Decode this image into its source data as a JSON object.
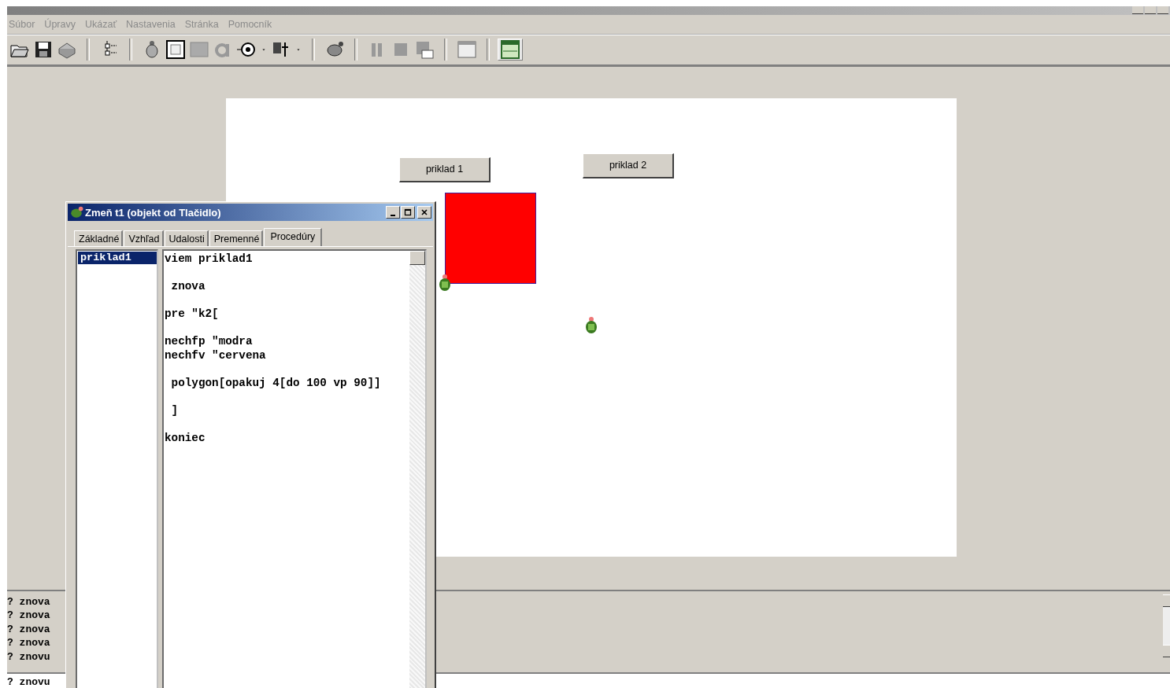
{
  "menu": [
    {
      "label": "Súbor"
    },
    {
      "label": "Úpravy"
    },
    {
      "label": "Ukázať"
    },
    {
      "label": "Nastavenia"
    },
    {
      "label": "Stránka"
    },
    {
      "label": "Pomocník"
    }
  ],
  "page": {
    "buttons": [
      {
        "label": "priklad 1"
      },
      {
        "label": "priklad 2"
      }
    ]
  },
  "history": [
    "? znova",
    "? znova",
    "? znova",
    "? znova",
    "? znovu"
  ],
  "command_line": {
    "value": "? znovu"
  },
  "dialog": {
    "title": "Zmeň t1 (objekt od Tlačidlo)",
    "tabs": [
      {
        "label": "Základné",
        "selected": false
      },
      {
        "label": "Vzhľad",
        "selected": false
      },
      {
        "label": "Udalosti",
        "selected": false
      },
      {
        "label": "Premenné",
        "selected": false
      },
      {
        "label": "Procedúry",
        "selected": true
      }
    ],
    "procedures": [
      {
        "name": "priklad1",
        "selected": true
      }
    ],
    "code": "viem priklad1\n\n znova\n\npre \"k2[\n\nnechfp \"modra\nnechfv \"cervena\n\n polygon[opakuj 4[do 100 vp 90]]\n\n ]\n\nkoniec"
  }
}
